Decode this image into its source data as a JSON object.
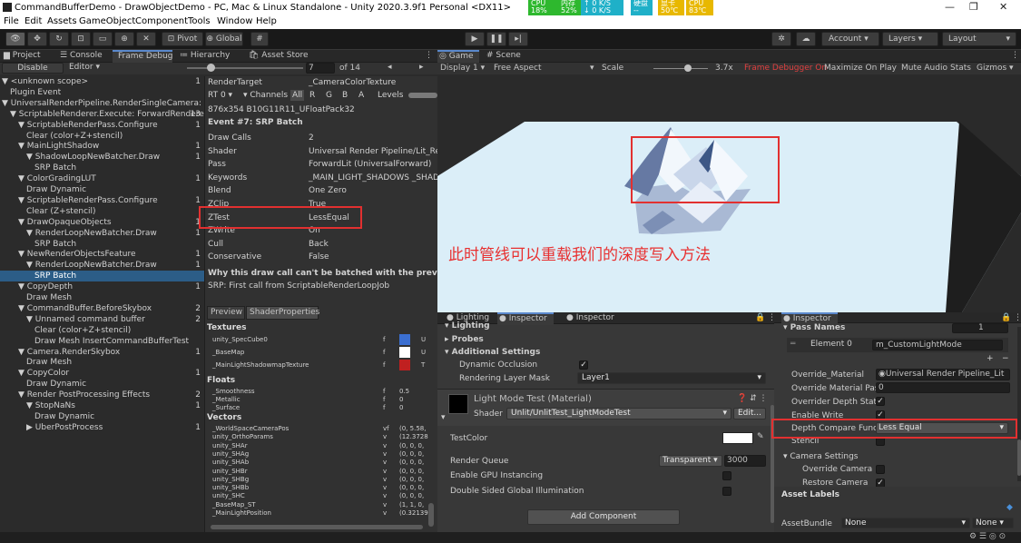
{
  "titlebar": {
    "title": "CommandBufferDemo - DrawObjectDemo - PC, Mac & Linux Standalone - Unity 2020.3.9f1 Personal <DX11>"
  },
  "perf": {
    "cpu_label": "CPU",
    "cpu_val": "18%",
    "mem_label": "内存",
    "mem_val": "52%",
    "up": "0 K/S",
    "down": "0 K/S",
    "disk_label": "硬盘",
    "disk_val": "--",
    "gpu_label": "显卡",
    "gpu_val": "50℃",
    "cpu2_label": "CPU",
    "cpu2_val": "83℃",
    "colors": {
      "green": "#2eb82e",
      "orange": "#f0a030",
      "cyan": "#1fb0c8",
      "yellow": "#e8b800"
    }
  },
  "menu": [
    "File",
    "Edit",
    "Assets",
    "GameObject",
    "Component",
    "Tools",
    "Window",
    "Help"
  ],
  "toolbar": {
    "pivot": "Pivot",
    "global": "Global",
    "account": "Account",
    "layers": "Layers",
    "layout": "Layout"
  },
  "left_tabs": [
    "Project",
    "Console",
    "Frame Debug",
    "Hierarchy",
    "Asset Store"
  ],
  "fd": {
    "disable": "Disable",
    "editor": "Editor",
    "current": "7",
    "of": "of 14",
    "tree": [
      {
        "label": "<unknown scope>",
        "count": "1",
        "indent": 0,
        "arrow": "▼"
      },
      {
        "label": "Plugin Event",
        "count": "",
        "indent": 1,
        "arrow": ""
      },
      {
        "label": "UniversalRenderPipeline.RenderSingleCamera: 13",
        "count": "",
        "indent": 0,
        "arrow": "▼"
      },
      {
        "label": "ScriptableRenderer.Execute: ForwardRenderer",
        "count": "13",
        "indent": 1,
        "arrow": "▼"
      },
      {
        "label": "ScriptableRenderPass.Configure",
        "count": "1",
        "indent": 2,
        "arrow": "▼"
      },
      {
        "label": "Clear (color+Z+stencil)",
        "count": "",
        "indent": 3,
        "arrow": ""
      },
      {
        "label": "MainLightShadow",
        "count": "1",
        "indent": 2,
        "arrow": "▼"
      },
      {
        "label": "ShadowLoopNewBatcher.Draw",
        "count": "1",
        "indent": 3,
        "arrow": "▼"
      },
      {
        "label": "SRP Batch",
        "count": "",
        "indent": 4,
        "arrow": ""
      },
      {
        "label": "ColorGradingLUT",
        "count": "1",
        "indent": 2,
        "arrow": "▼"
      },
      {
        "label": "Draw Dynamic",
        "count": "",
        "indent": 3,
        "arrow": ""
      },
      {
        "label": "ScriptableRenderPass.Configure",
        "count": "1",
        "indent": 2,
        "arrow": "▼"
      },
      {
        "label": "Clear (Z+stencil)",
        "count": "",
        "indent": 3,
        "arrow": ""
      },
      {
        "label": "DrawOpaqueObjects",
        "count": "1",
        "indent": 2,
        "arrow": "▼"
      },
      {
        "label": "RenderLoopNewBatcher.Draw",
        "count": "1",
        "indent": 3,
        "arrow": "▼"
      },
      {
        "label": "SRP Batch",
        "count": "",
        "indent": 4,
        "arrow": ""
      },
      {
        "label": "NewRenderObjectsFeature",
        "count": "1",
        "indent": 2,
        "arrow": "▼"
      },
      {
        "label": "RenderLoopNewBatcher.Draw",
        "count": "1",
        "indent": 3,
        "arrow": "▼"
      },
      {
        "label": "SRP Batch",
        "count": "",
        "indent": 4,
        "arrow": "",
        "selected": true
      },
      {
        "label": "CopyDepth",
        "count": "1",
        "indent": 2,
        "arrow": "▼"
      },
      {
        "label": "Draw Mesh",
        "count": "",
        "indent": 3,
        "arrow": ""
      },
      {
        "label": "CommandBuffer.BeforeSkybox",
        "count": "2",
        "indent": 2,
        "arrow": "▼"
      },
      {
        "label": "Unnamed command buffer",
        "count": "2",
        "indent": 3,
        "arrow": "▼"
      },
      {
        "label": "Clear (color+Z+stencil)",
        "count": "",
        "indent": 4,
        "arrow": ""
      },
      {
        "label": "Draw Mesh InsertCommandBufferTest",
        "count": "",
        "indent": 4,
        "arrow": ""
      },
      {
        "label": "Camera.RenderSkybox",
        "count": "1",
        "indent": 2,
        "arrow": "▼"
      },
      {
        "label": "Draw Mesh",
        "count": "",
        "indent": 3,
        "arrow": ""
      },
      {
        "label": "CopyColor",
        "count": "1",
        "indent": 2,
        "arrow": "▼"
      },
      {
        "label": "Draw Dynamic",
        "count": "",
        "indent": 3,
        "arrow": ""
      },
      {
        "label": "Render PostProcessing Effects",
        "count": "2",
        "indent": 2,
        "arrow": "▼"
      },
      {
        "label": "StopNaNs",
        "count": "1",
        "indent": 3,
        "arrow": "▼"
      },
      {
        "label": "Draw Dynamic",
        "count": "",
        "indent": 4,
        "arrow": ""
      },
      {
        "label": "UberPostProcess",
        "count": "1",
        "indent": 3,
        "arrow": "▶"
      }
    ],
    "rendertarget_k": "RenderTarget",
    "rendertarget_v": "_CameraColorTexture",
    "rt0": "RT 0",
    "channels": "Channels",
    "ch": [
      "All",
      "R",
      "G",
      "B",
      "A"
    ],
    "levels": "Levels",
    "format": "876x354 B10G11R11_UFloatPack32",
    "event": "Event #7: SRP Batch",
    "props": [
      {
        "k": "Draw Calls",
        "v": "2"
      },
      {
        "k": "Shader",
        "v": "Universal Render Pipeline/Lit_Rer"
      },
      {
        "k": "Pass",
        "v": "ForwardLit (UniversalForward)"
      },
      {
        "k": "Keywords",
        "v": "_MAIN_LIGHT_SHADOWS _SHADC"
      },
      {
        "k": "Blend",
        "v": "One Zero"
      },
      {
        "k": "ZClip",
        "v": "True"
      },
      {
        "k": "ZTest",
        "v": "LessEqual"
      },
      {
        "k": "ZWrite",
        "v": "On"
      },
      {
        "k": "Cull",
        "v": "Back"
      },
      {
        "k": "Conservative",
        "v": "False"
      }
    ],
    "why": "Why this draw call can't be batched with the previous one",
    "why2": "SRP: First call from ScriptableRenderLoopJob",
    "subtabs": [
      "Preview",
      "ShaderProperties"
    ],
    "textures_h": "Textures",
    "textures": [
      {
        "n": "unity_SpecCube0",
        "t": "f",
        "x": "U"
      },
      {
        "n": "_BaseMap",
        "t": "f",
        "x": "U"
      },
      {
        "n": "_MainLightShadowmapTexture",
        "t": "f",
        "x": "T"
      }
    ],
    "floats_h": "Floats",
    "floats": [
      {
        "n": "_Smoothness",
        "t": "f",
        "v": "0.5"
      },
      {
        "n": "_Metallic",
        "t": "f",
        "v": "0"
      },
      {
        "n": "_Surface",
        "t": "f",
        "v": "0"
      }
    ],
    "vectors_h": "Vectors",
    "vectors": [
      {
        "n": "_WorldSpaceCameraPos",
        "t": "vf",
        "v": "(0, 5.58,"
      },
      {
        "n": "unity_OrthoParams",
        "t": "v",
        "v": "(12.3728"
      },
      {
        "n": "unity_SHAr",
        "t": "v",
        "v": "(0, 0, 0,"
      },
      {
        "n": "unity_SHAg",
        "t": "v",
        "v": "(0, 0, 0,"
      },
      {
        "n": "unity_SHAb",
        "t": "v",
        "v": "(0, 0, 0,"
      },
      {
        "n": "unity_SHBr",
        "t": "v",
        "v": "(0, 0, 0,"
      },
      {
        "n": "unity_SHBg",
        "t": "v",
        "v": "(0, 0, 0,"
      },
      {
        "n": "unity_SHBb",
        "t": "v",
        "v": "(0, 0, 0,"
      },
      {
        "n": "unity_SHC",
        "t": "v",
        "v": "(0, 0, 0,"
      },
      {
        "n": "_BaseMap_ST",
        "t": "v",
        "v": "(1, 1, 0,"
      },
      {
        "n": "_MainLightPosition",
        "t": "v",
        "v": "(0.32139"
      }
    ]
  },
  "game": {
    "tabs": [
      "Game",
      "Scene"
    ],
    "display": "Display 1",
    "aspect": "Free Aspect",
    "scale": "Scale",
    "scale_val": "3.7x",
    "fd_on": "Frame Debugger On",
    "maxplay": "Maximize On Play",
    "mute": "Mute Audio",
    "stats": "Stats",
    "gizmos": "Gizmos",
    "annotation": "此时管线可以重载我们的深度写入方法"
  },
  "insp1": {
    "tabs": [
      "Lighting",
      "Inspector",
      "Inspector"
    ],
    "lighting": "Lighting",
    "probes": "Probes",
    "additional": "Additional Settings",
    "dyn_occ": "Dynamic Occlusion",
    "rlm": "Rendering Layer Mask",
    "rlm_v": "Layer1",
    "mat_name": "Light Mode Test (Material)",
    "shader_k": "Shader",
    "shader_v": "Unlit/UnlitTest_LightModeTest",
    "edit": "Edit...",
    "testcolor": "TestColor",
    "rq": "Render Queue",
    "rq_mode": "Transparent",
    "rq_val": "3000",
    "gpu_inst": "Enable GPU Instancing",
    "dsgi": "Double Sided Global Illumination",
    "add_comp": "Add Component"
  },
  "insp2": {
    "tab": "Inspector",
    "pass_names": "Pass Names",
    "pass_count": "1",
    "el0": "Element 0",
    "el0_v": "m_CustomLightMode",
    "override_mat": "Override_Material",
    "override_mat_v": "Universal Render Pipeline_Lit",
    "omp": "Override Material Pas",
    "omp_v": "0",
    "ods": "Overrider Depth State",
    "ew": "Enable Write",
    "dcf": "Depth Compare Func",
    "dcf_v": "Less Equal",
    "stencil": "Stencil",
    "cam_settings": "Camera Settings",
    "override_cam": "Override Camera",
    "restore_cam": "Restore Camera",
    "asset_labels": "Asset Labels",
    "asset_bundle": "AssetBundle",
    "ab_v": "None",
    "ab_v2": "None"
  }
}
